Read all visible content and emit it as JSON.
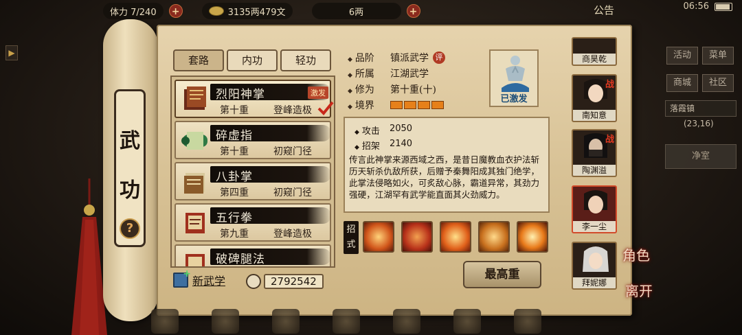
{
  "topbar": {
    "stamina": "体力 7/240",
    "money": "3135两479文",
    "ingots": "6两",
    "announce": "公告",
    "clock": "06:56"
  },
  "scroll": {
    "title_1": "武",
    "title_2": "功",
    "help": "?"
  },
  "tabs": [
    "套路",
    "内功",
    "轻功"
  ],
  "skills": [
    {
      "name": "烈阳神掌",
      "level": "第十重",
      "stage": "登峰造极",
      "badge": "激发",
      "selected": true
    },
    {
      "name": "碎虚指",
      "level": "第十重",
      "stage": "初窥门径"
    },
    {
      "name": "八卦掌",
      "level": "第四重",
      "stage": "初窥门径"
    },
    {
      "name": "五行拳",
      "level": "第九重",
      "stage": "登峰造极"
    },
    {
      "name": "破碑腿法",
      "level": "",
      "stage": ""
    }
  ],
  "footer": {
    "new_skill": "新武学",
    "points": "2792542"
  },
  "detail": {
    "grade_label": "品阶",
    "grade": "镇派武学",
    "eval": "评",
    "belong_label": "所属",
    "belong": "江湖武学",
    "cultivation_label": "修为",
    "cultivation": "第十重(十)",
    "realm_label": "境界",
    "activated": "已激发",
    "attack_label": "攻击",
    "attack": "2050",
    "parry_label": "招架",
    "parry": "2140",
    "description": "传言此神掌来源西域之西，是昔日魔教血衣护法斩历天斩杀仇敌所获，后赠予秦舞阳成其独门绝学，此掌法侵略如火，可炙敌心脉，霸道异常，其劲力强硬，江湖罕有武学能直面其火劲威力。",
    "moves_label": "招式",
    "max_button": "最高重"
  },
  "characters": [
    {
      "name": "商昊乾"
    },
    {
      "name": "南知意",
      "tag": "战"
    },
    {
      "name": "陶渊溢",
      "tag": "战"
    },
    {
      "name": "李一尘",
      "selected": true
    },
    {
      "name": "拜妮娜"
    }
  ],
  "side_actions": {
    "role": "角色",
    "leave": "离开"
  },
  "right_menu": {
    "activity": "活动",
    "menu": "菜单",
    "shop": "商城",
    "community": "社区",
    "location": "落霞镇",
    "coords": "(23,16)",
    "room": "净室"
  }
}
